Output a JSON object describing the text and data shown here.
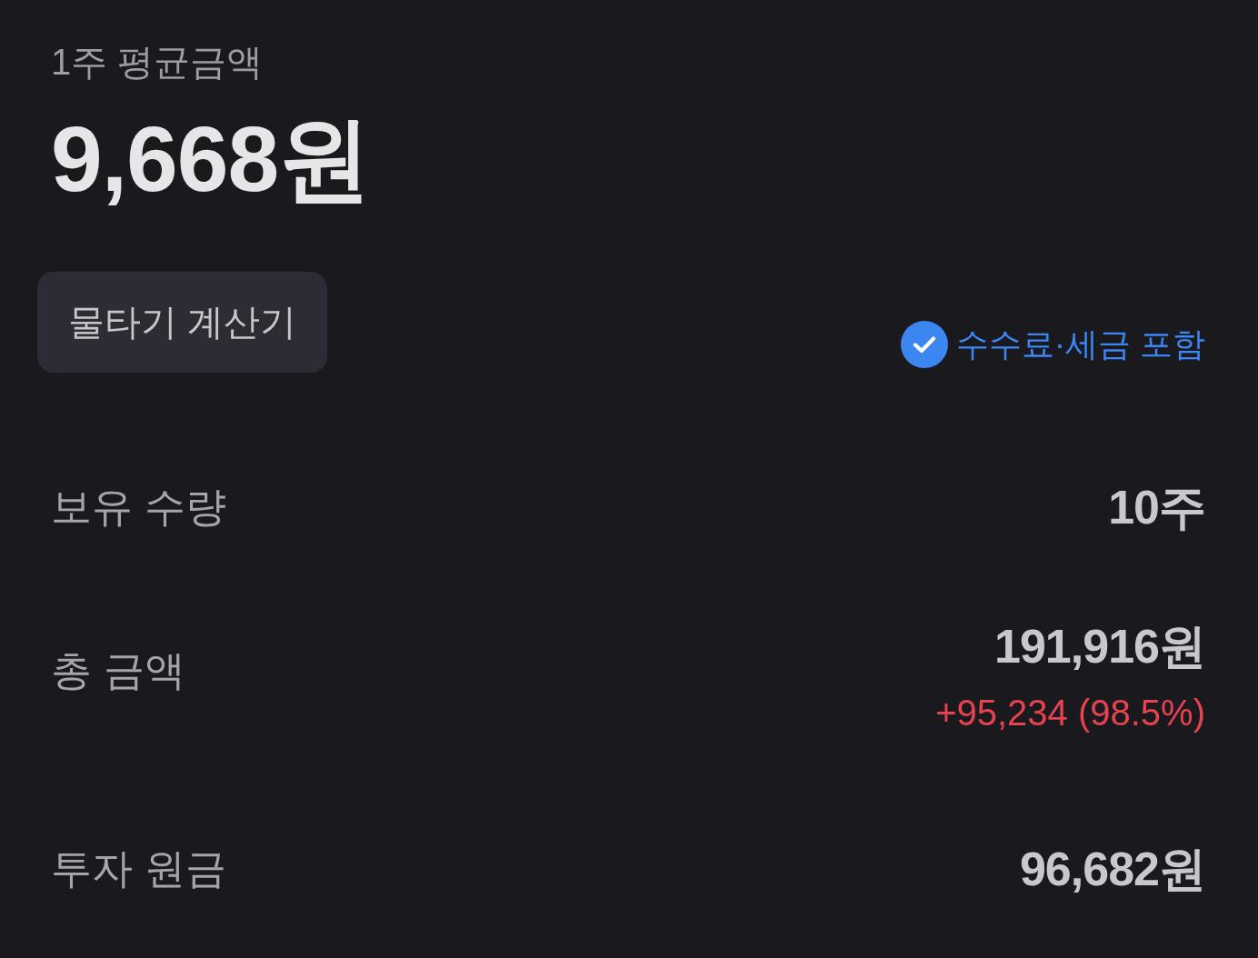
{
  "header": {
    "label": "1주 평균금액",
    "value": "9,668원"
  },
  "calculator_button": {
    "label": "물타기 계산기"
  },
  "fee_tax_toggle": {
    "label": "수수료·세금 포함",
    "checked": true
  },
  "summary_rows": [
    {
      "label": "보유 수량",
      "value": "10주"
    },
    {
      "label": "총 금액",
      "value": "191,916원",
      "change": "+95,234 (98.5%)",
      "gain": true
    },
    {
      "label": "투자 원금",
      "value": "96,682원"
    }
  ]
}
